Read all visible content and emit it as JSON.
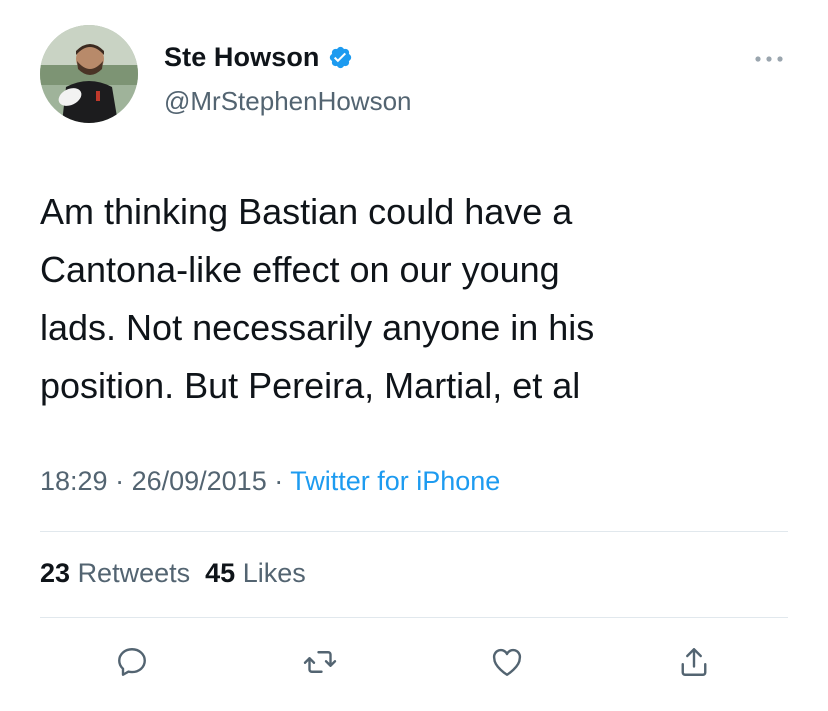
{
  "user": {
    "display_name": "Ste Howson",
    "handle": "@MrStephenHowson",
    "verified": true
  },
  "tweet": {
    "text_lines": [
      "Am thinking Bastian could have a",
      "Cantona-like effect on our young",
      "lads. Not necessarily anyone in his",
      "position. But Pereira, Martial, et al"
    ],
    "time": "18:29",
    "separator": " · ",
    "date": "26/09/2015",
    "source": "Twitter for iPhone"
  },
  "stats": {
    "retweets_count": "23",
    "retweets_label": "Retweets",
    "likes_count": "45",
    "likes_label": "Likes"
  },
  "actions": [
    {
      "icon": "reply-icon"
    },
    {
      "icon": "retweet-icon"
    },
    {
      "icon": "like-icon"
    },
    {
      "icon": "share-icon"
    }
  ],
  "colors": {
    "accent": "#1d9bf0",
    "secondary_text": "#536471",
    "primary_text": "#0f1419",
    "divider": "#e1e8ed"
  }
}
